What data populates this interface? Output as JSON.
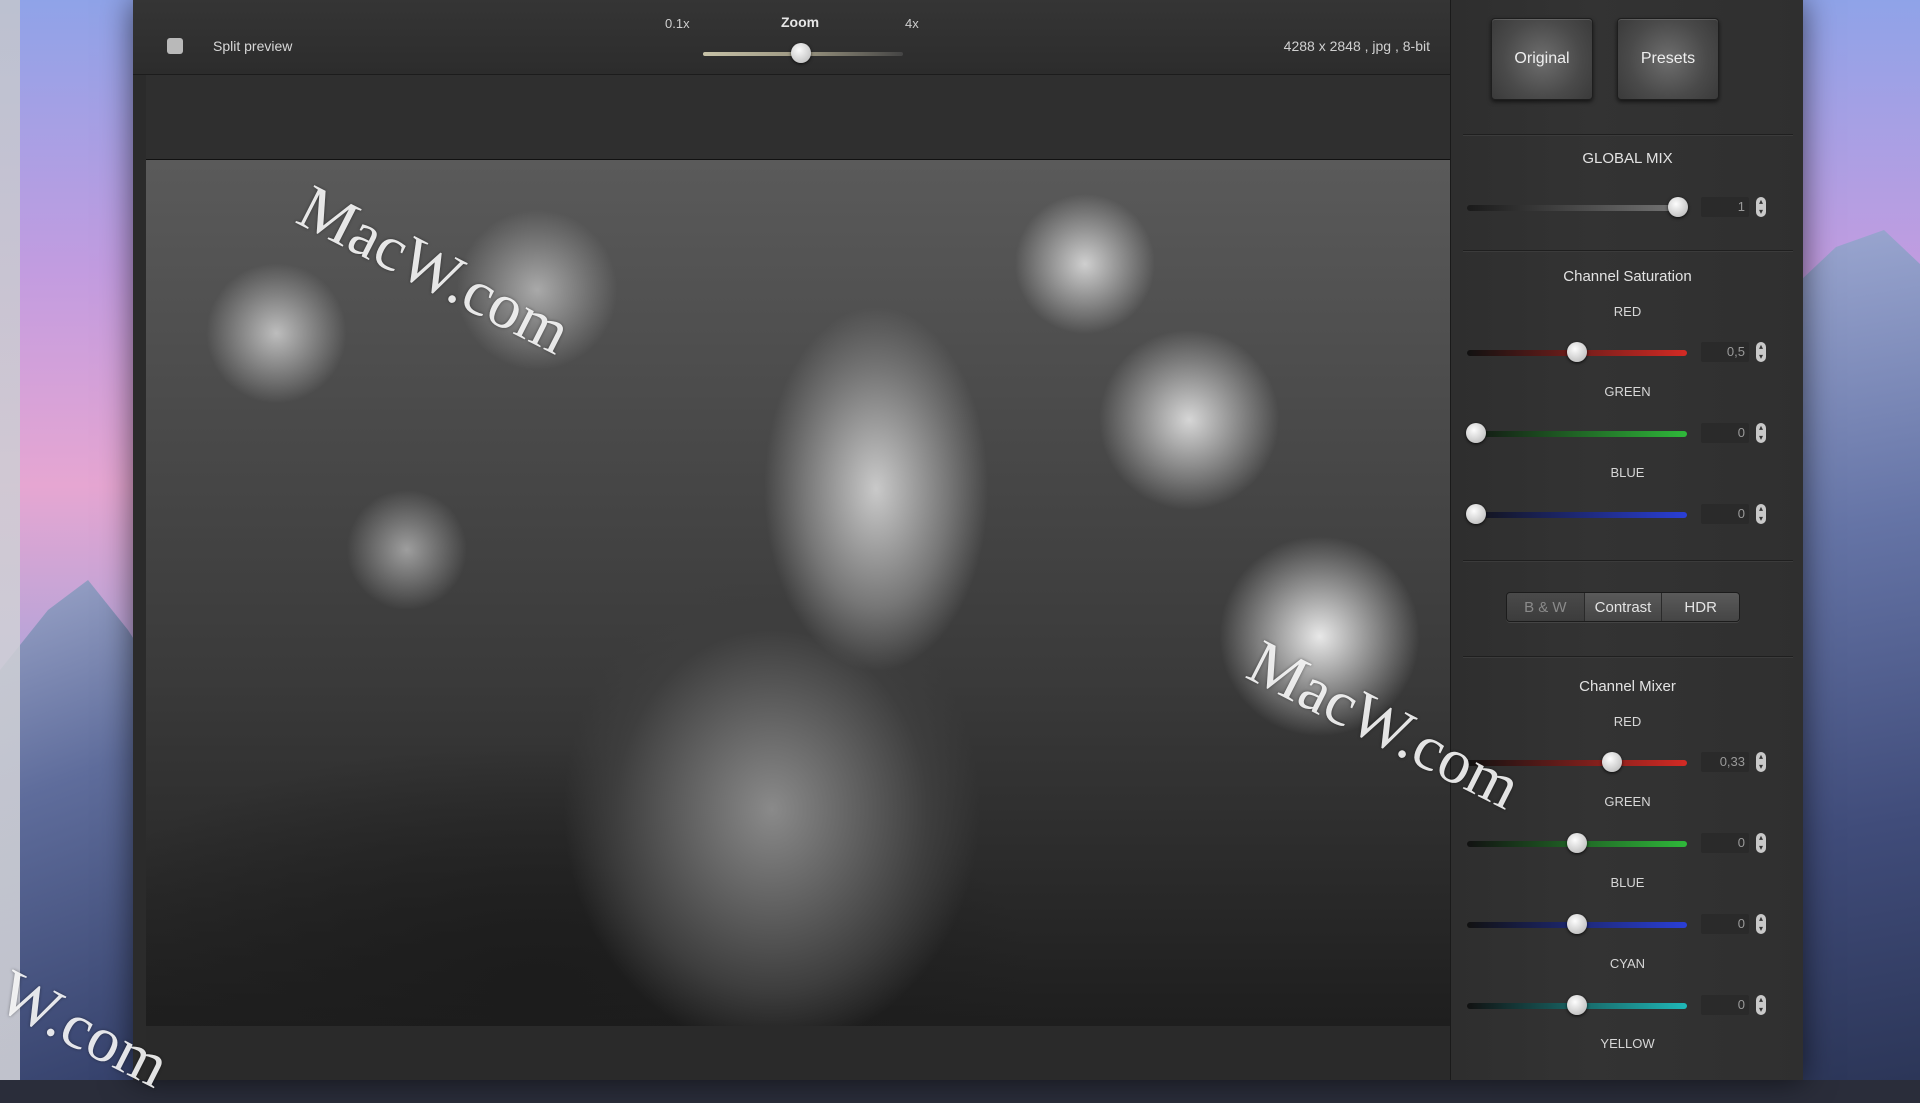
{
  "toolbar": {
    "split_preview_label": "Split preview",
    "zoom_title": "Zoom",
    "zoom_min": "0.1x",
    "zoom_max": "4x",
    "image_info": "4288 x 2848 , jpg , 8-bit"
  },
  "watermark": "MacW.com",
  "watermark_partial": "W.com",
  "panel": {
    "original_label": "Original",
    "presets_label": "Presets",
    "global_mix": {
      "title": "GLOBAL MIX",
      "value": "1"
    },
    "channel_saturation": {
      "title": "Channel Saturation",
      "channels": [
        {
          "label": "RED",
          "value": "0,5"
        },
        {
          "label": "GREEN",
          "value": "0"
        },
        {
          "label": "BLUE",
          "value": "0"
        }
      ]
    },
    "modes": {
      "bw": "B & W",
      "contrast": "Contrast",
      "hdr": "HDR"
    },
    "channel_mixer": {
      "title": "Channel Mixer",
      "channels": [
        {
          "label": "RED",
          "value": "0,33"
        },
        {
          "label": "GREEN",
          "value": "0"
        },
        {
          "label": "BLUE",
          "value": "0"
        },
        {
          "label": "CYAN",
          "value": "0"
        },
        {
          "label": "YELLOW",
          "value": ""
        }
      ]
    }
  },
  "colors": {
    "red": "#d32a24",
    "green": "#2fb83a",
    "blue": "#2a3fd6",
    "cyan": "#1fb8b8"
  }
}
